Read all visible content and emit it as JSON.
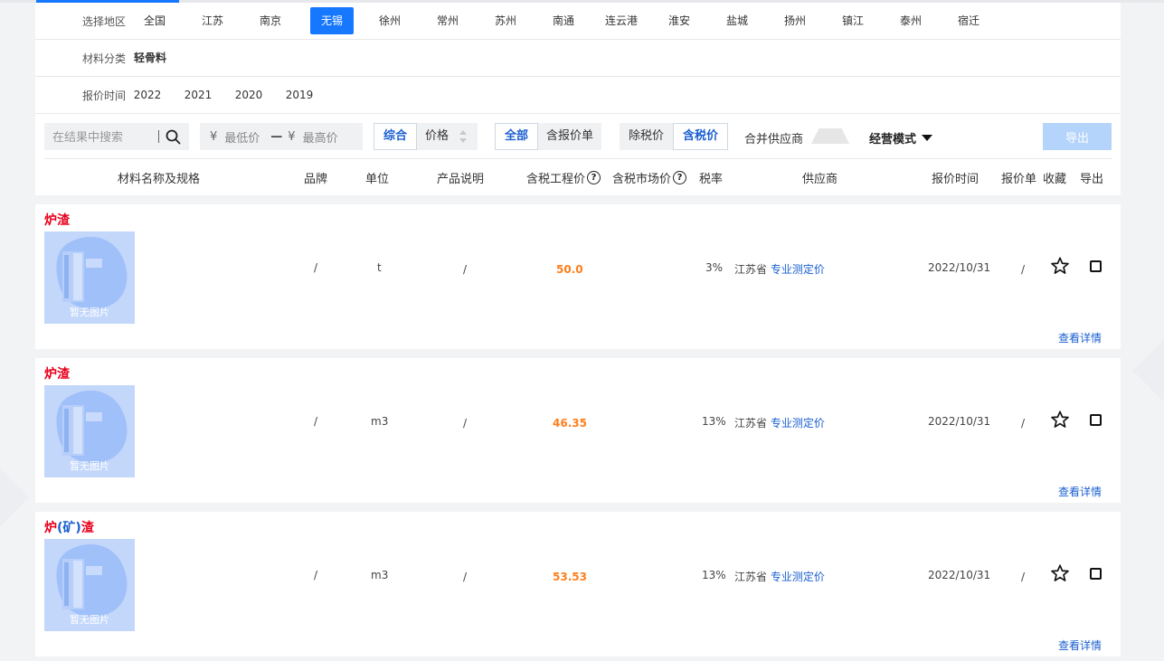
{
  "filters": {
    "region": {
      "label": "选择地区",
      "options": [
        "全国",
        "江苏",
        "南京",
        "无锡",
        "徐州",
        "常州",
        "苏州",
        "南通",
        "连云港",
        "淮安",
        "盐城",
        "扬州",
        "镇江",
        "泰州",
        "宿迁"
      ],
      "selected": "无锡"
    },
    "category": {
      "label": "材料分类",
      "options": [
        "轻骨料"
      ]
    },
    "quote_time": {
      "label": "报价时间",
      "options": [
        "2022",
        "2021",
        "2020",
        "2019"
      ]
    }
  },
  "toolbar": {
    "search_placeholder": "在结果中搜索",
    "price_currency": "¥",
    "price_min_placeholder": "最低价",
    "price_sep": "—",
    "price_max_placeholder": "最高价",
    "sort": {
      "options": [
        "综合",
        "价格"
      ],
      "selected": "综合"
    },
    "quote_filter": {
      "options": [
        "全部",
        "含报价单"
      ],
      "selected": "全部"
    },
    "tax_mode": {
      "options": [
        "除税价",
        "含税价"
      ],
      "selected": "含税价"
    },
    "merge_supplier_label": "合并供应商",
    "mode_label": "经营模式",
    "export_label": "导出"
  },
  "columns": {
    "name": "材料名称及规格",
    "brand": "品牌",
    "unit": "单位",
    "desc": "产品说明",
    "eng_price": "含税工程价",
    "market_price": "含税市场价",
    "tax_rate": "税率",
    "supplier": "供应商",
    "quote_time": "报价时间",
    "quote_doc": "报价单",
    "favorite": "收藏",
    "export": "导出"
  },
  "placeholder_image_text": "暂无图片",
  "help_symbol": "?",
  "products": [
    {
      "name": "炉渣",
      "name_bracket": "",
      "name_suffix": "",
      "brand": "/",
      "unit": "t",
      "desc": "/",
      "eng_price": "50.0",
      "tax_rate": "3%",
      "province": "江苏省",
      "supplier_link": "专业测定价",
      "quote_date": "2022/10/31",
      "quote_doc": "/",
      "detail_link": "查看详情"
    },
    {
      "name": "炉渣",
      "name_bracket": "",
      "name_suffix": "",
      "brand": "/",
      "unit": "m3",
      "desc": "/",
      "eng_price": "46.35",
      "tax_rate": "13%",
      "province": "江苏省",
      "supplier_link": "专业测定价",
      "quote_date": "2022/10/31",
      "quote_doc": "/",
      "detail_link": "查看详情"
    },
    {
      "name": "炉",
      "name_bracket": "(矿)",
      "name_suffix": "渣",
      "brand": "/",
      "unit": "m3",
      "desc": "/",
      "eng_price": "53.53",
      "tax_rate": "13%",
      "province": "江苏省",
      "supplier_link": "专业测定价",
      "quote_date": "2022/10/31",
      "quote_doc": "/",
      "detail_link": "查看详情"
    }
  ],
  "colors": {
    "accent": "#1677ff",
    "price": "#ff7e1c",
    "name": "#e8001c",
    "link": "#1a5fd0"
  }
}
